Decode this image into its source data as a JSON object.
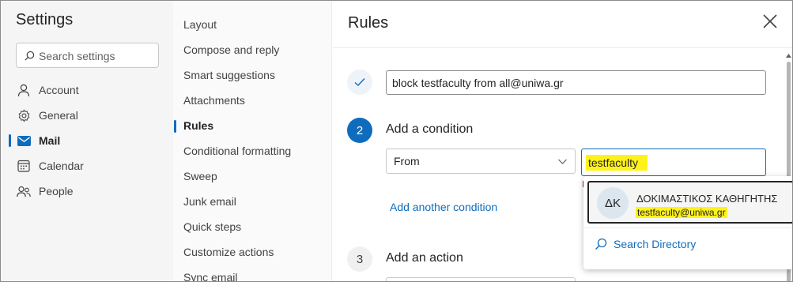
{
  "nav": {
    "title": "Settings",
    "search_placeholder": "Search settings",
    "items": [
      {
        "label": "Account",
        "icon": "person-icon"
      },
      {
        "label": "General",
        "icon": "gear-icon"
      },
      {
        "label": "Mail",
        "icon": "mail-icon",
        "active": true
      },
      {
        "label": "Calendar",
        "icon": "calendar-icon"
      },
      {
        "label": "People",
        "icon": "people-icon"
      }
    ]
  },
  "mail_sections": [
    "Layout",
    "Compose and reply",
    "Smart suggestions",
    "Attachments",
    "Rules",
    "Conditional formatting",
    "Sweep",
    "Junk email",
    "Quick steps",
    "Customize actions",
    "Sync email"
  ],
  "active_section": "Rules",
  "rules": {
    "title": "Rules",
    "rule_name": "block testfaculty from all@uniwa.gr",
    "step2": {
      "number": "2",
      "label": "Add a condition"
    },
    "condition_type": "From",
    "condition_value": "testfaculty",
    "add_condition_link": "Add another condition",
    "step3": {
      "number": "3",
      "label": "Add an action"
    }
  },
  "suggestions": {
    "person": {
      "initials": "ΔΚ",
      "name": "ΔΟΚΙΜΑΣΤΙΚΟΣ ΚΑΘΗΓΗΤΗΣ",
      "email": "testfaculty@uniwa.gr"
    },
    "search_directory": "Search Directory"
  },
  "colors": {
    "accent": "#0f6cbd",
    "highlight": "#fff21a"
  }
}
